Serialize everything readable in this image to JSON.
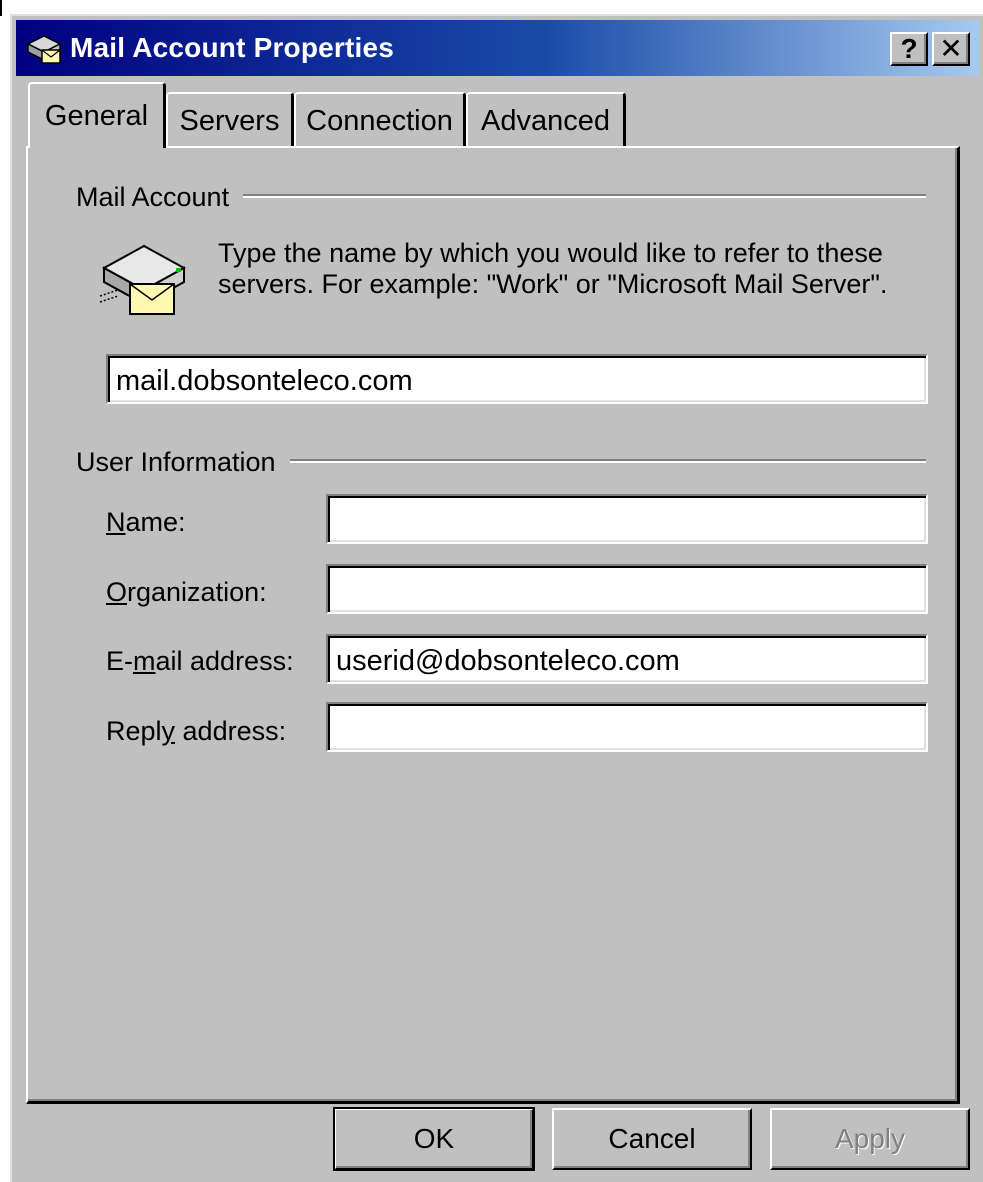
{
  "window": {
    "title": "Mail Account Properties",
    "help_label": "?",
    "close_label": "✕"
  },
  "tabs": [
    {
      "label": "General",
      "active": true
    },
    {
      "label": "Servers",
      "active": false
    },
    {
      "label": "Connection",
      "active": false
    },
    {
      "label": "Advanced",
      "active": false
    }
  ],
  "mail_account": {
    "group_label": "Mail Account",
    "description": "Type the name by which you would like to refer to these servers.  For example: \"Work\" or \"Microsoft Mail Server\".",
    "account_name_value": "mail.dobsonteleco.com"
  },
  "user_information": {
    "group_label": "User Information",
    "name": {
      "label_accel": "N",
      "label_rest": "ame:",
      "value": ""
    },
    "organization": {
      "label_accel": "O",
      "label_rest": "rganization:",
      "value": ""
    },
    "email": {
      "label_pre": "E-",
      "label_accel": "m",
      "label_rest": "ail address:",
      "value": "userid@dobsonteleco.com"
    },
    "reply": {
      "label_pre": "Repl",
      "label_accel": "y",
      "label_rest": " address:",
      "value": ""
    }
  },
  "buttons": {
    "ok": "OK",
    "cancel": "Cancel",
    "apply": "Apply",
    "apply_enabled": false
  },
  "colors": {
    "titlebar_start": "#000080",
    "titlebar_end": "#a6caf0",
    "face": "#c0c0c0"
  },
  "icons": {
    "title": "mail-server-icon",
    "account": "mail-server-envelope-icon"
  }
}
